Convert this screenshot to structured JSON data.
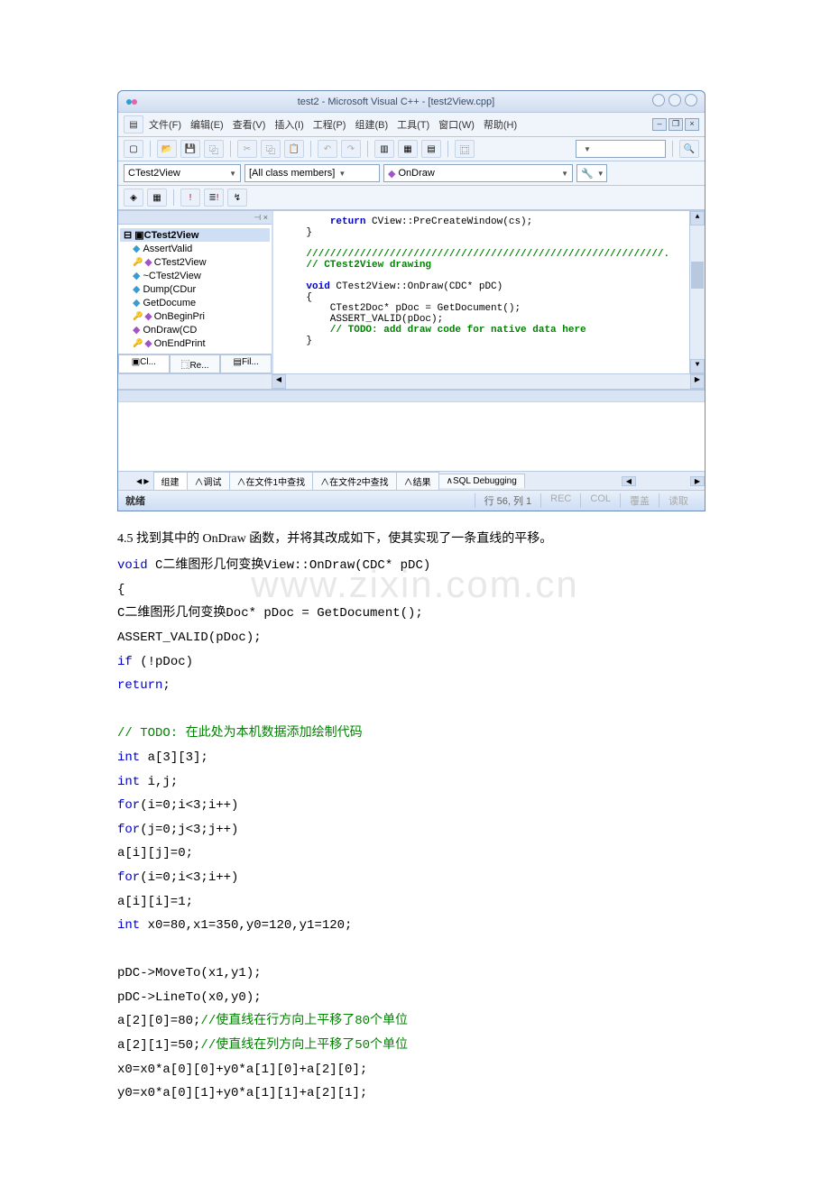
{
  "ide": {
    "title": "test2 - Microsoft Visual C++ - [test2View.cpp]",
    "menu": [
      "文件(F)",
      "编辑(E)",
      "查看(V)",
      "插入(I)",
      "工程(P)",
      "组建(B)",
      "工具(T)",
      "窗口(W)",
      "帮助(H)"
    ],
    "combo1": "CTest2View",
    "combo2": "[All class members]",
    "combo3": "OnDraw",
    "tree": {
      "root": "CTest2View",
      "items": [
        {
          "icon": "cyan",
          "label": "AssertValid"
        },
        {
          "icon": "key",
          "label": "CTest2View"
        },
        {
          "icon": "cyan",
          "label": "~CTest2View"
        },
        {
          "icon": "cyan",
          "label": "Dump(CDur"
        },
        {
          "icon": "cyan",
          "label": "GetDocume"
        },
        {
          "icon": "key",
          "label": "OnBeginPri"
        },
        {
          "icon": "purple",
          "label": "OnDraw(CD"
        },
        {
          "icon": "key",
          "label": "OnEndPrint"
        }
      ],
      "tabs": [
        "Cl...",
        "Re...",
        "Fil..."
      ]
    },
    "code": {
      "l1_kw": "return",
      "l1_rest": " CView::PreCreateWindow(cs);",
      "l2": "}",
      "l3": "////////////////////////////////////////////////////////////.",
      "l4": "// CTest2View drawing",
      "l5_kw": "void",
      "l5_rest": " CTest2View::OnDraw(CDC* pDC)",
      "l6": "{",
      "l7": "    CTest2Doc* pDoc = GetDocument();",
      "l8": "    ASSERT_VALID(pDoc);",
      "l9": "    // TODO: add draw code for native data here",
      "l10": "}"
    },
    "output_tabs": [
      "组建",
      "调试",
      "在文件1中查找",
      "在文件2中查找",
      "结果",
      "SQL Debugging"
    ],
    "status_ready": "就绪",
    "status_pos": "行 56, 列 1",
    "status_flags": [
      "REC",
      "COL",
      "覆盖",
      "读取"
    ]
  },
  "doc": {
    "intro": "4.5 找到其中的 OnDraw 函数，并将其改成如下，使其实现了一条直线的平移。",
    "lines": [
      {
        "t": "void",
        "c": "kw"
      },
      {
        "t": " C二维图形几何变换View::OnDraw(CDC* pDC)",
        "c": ""
      },
      {
        "br": 1
      },
      {
        "t": "{",
        "c": ""
      },
      {
        "br": 1
      },
      {
        "t": "    C二维图形几何变换Doc* pDoc = GetDocument();",
        "c": ""
      },
      {
        "br": 1
      },
      {
        "t": "    ASSERT_VALID(pDoc);",
        "c": ""
      },
      {
        "br": 1
      },
      {
        "t": "    if",
        "c": "kw"
      },
      {
        "t": " (!pDoc)",
        "c": ""
      },
      {
        "br": 1
      },
      {
        "t": "        return",
        "c": "kw"
      },
      {
        "t": ";",
        "c": ""
      },
      {
        "br": 1
      },
      {
        "t": "",
        "c": ""
      },
      {
        "br": 1
      },
      {
        "t": "    // TODO: 在此处为本机数据添加绘制代码",
        "c": "cmt"
      },
      {
        "br": 1
      },
      {
        "t": "    int",
        "c": "kw"
      },
      {
        "t": " a[3][3];",
        "c": ""
      },
      {
        "br": 1
      },
      {
        "t": "    int",
        "c": "kw"
      },
      {
        "t": " i,j;",
        "c": ""
      },
      {
        "br": 1
      },
      {
        "t": "    for",
        "c": "kw"
      },
      {
        "t": "(i=0;i<3;i++)",
        "c": ""
      },
      {
        "br": 1
      },
      {
        "t": "        for",
        "c": "kw"
      },
      {
        "t": "(j=0;j<3;j++)",
        "c": ""
      },
      {
        "br": 1
      },
      {
        "t": "            a[i][j]=0;",
        "c": ""
      },
      {
        "br": 1
      },
      {
        "t": "    for",
        "c": "kw"
      },
      {
        "t": "(i=0;i<3;i++)",
        "c": ""
      },
      {
        "br": 1
      },
      {
        "t": "        a[i][i]=1;",
        "c": ""
      },
      {
        "br": 1
      },
      {
        "t": "    int",
        "c": "kw"
      },
      {
        "t": "  x0=80,x1=350,y0=120,y1=120;",
        "c": ""
      },
      {
        "br": 1
      },
      {
        "t": "",
        "c": ""
      },
      {
        "br": 1
      },
      {
        "t": "     pDC->MoveTo(x1,y1);",
        "c": ""
      },
      {
        "br": 1
      },
      {
        "t": "     pDC->LineTo(x0,y0);",
        "c": ""
      },
      {
        "br": 1
      },
      {
        "t": "    a[2][0]=80;",
        "c": ""
      },
      {
        "t": "//使直线在行方向上平移了80个单位",
        "c": "cmt"
      },
      {
        "br": 1
      },
      {
        "t": "     a[2][1]=50;",
        "c": ""
      },
      {
        "t": "//使直线在列方向上平移了50个单位",
        "c": "cmt"
      },
      {
        "br": 1
      },
      {
        "t": "     x0=x0*a[0][0]+y0*a[1][0]+a[2][0];",
        "c": ""
      },
      {
        "br": 1
      },
      {
        "t": "     y0=x0*a[0][1]+y0*a[1][1]+a[2][1];",
        "c": ""
      },
      {
        "br": 1
      }
    ]
  },
  "watermark": "www.zixin.com.cn"
}
